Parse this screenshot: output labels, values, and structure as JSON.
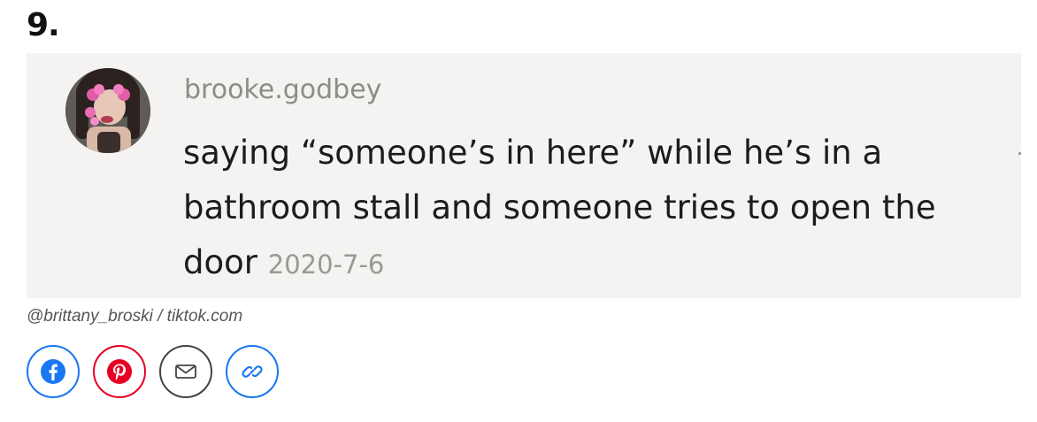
{
  "item": {
    "number": "9."
  },
  "screenshot": {
    "avatar_icon": "profile-avatar",
    "username": "brooke.godbey",
    "comment_text": "saying “someone’s in here” while he’s in a bathroom stall and someone tries to open the door",
    "date": "2020-7-6"
  },
  "credit": "@brittany_broski / tiktok.com",
  "share": {
    "buttons": [
      {
        "name": "facebook",
        "icon": "facebook-icon",
        "color": "#1877f2"
      },
      {
        "name": "pinterest",
        "icon": "pinterest-icon",
        "color": "#e60023"
      },
      {
        "name": "email",
        "icon": "mail-icon",
        "color": "#444444"
      },
      {
        "name": "copy-link",
        "icon": "link-icon",
        "color": "#1877f2"
      }
    ]
  },
  "colors": {
    "card_background": "#f4f3f1",
    "username": "#8e8c88",
    "comment": "#1c1c1c",
    "date": "#9a9894"
  }
}
